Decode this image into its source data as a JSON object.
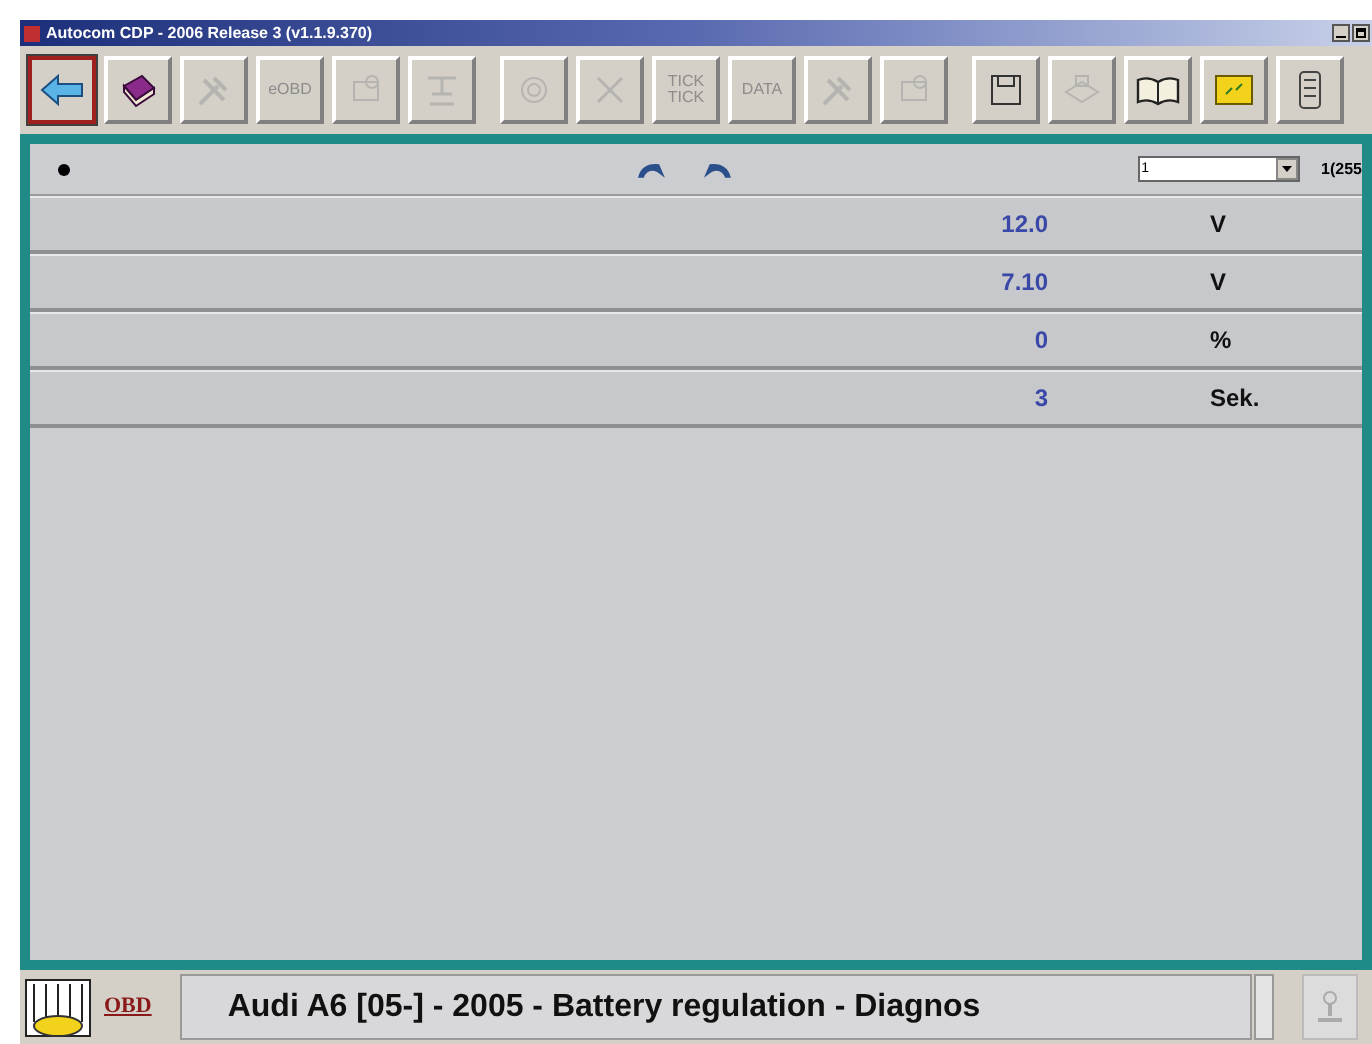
{
  "window": {
    "title": "Autocom CDP  -  2006 Release 3  (v1.1.9.370)"
  },
  "toolbar": [
    {
      "kind": "back",
      "selected": true,
      "disabled": false
    },
    {
      "kind": "book",
      "selected": false,
      "disabled": false
    },
    {
      "kind": "tools",
      "selected": false,
      "disabled": true
    },
    {
      "kind": "text",
      "label": "eOBD",
      "selected": false,
      "disabled": true
    },
    {
      "kind": "ecu",
      "selected": false,
      "disabled": true
    },
    {
      "kind": "stand",
      "selected": false,
      "disabled": true
    },
    {
      "kind": "circle",
      "selected": false,
      "disabled": true
    },
    {
      "kind": "cross",
      "selected": false,
      "disabled": true
    },
    {
      "kind": "text",
      "label": "TICK TICK",
      "selected": false,
      "disabled": true
    },
    {
      "kind": "text",
      "label": "DATA",
      "selected": false,
      "disabled": true
    },
    {
      "kind": "tools",
      "selected": false,
      "disabled": true
    },
    {
      "kind": "ecu",
      "selected": false,
      "disabled": true
    },
    {
      "kind": "save",
      "selected": false,
      "disabled": false
    },
    {
      "kind": "print",
      "selected": false,
      "disabled": true
    },
    {
      "kind": "open-book",
      "selected": false,
      "disabled": false
    },
    {
      "kind": "note",
      "selected": false,
      "disabled": false
    },
    {
      "kind": "phone",
      "selected": false,
      "disabled": false
    }
  ],
  "header": {
    "dropdown": {
      "value": "1"
    },
    "counter": "1(255"
  },
  "rows": [
    {
      "value": "12.0",
      "unit": "V"
    },
    {
      "value": "7.10",
      "unit": "V"
    },
    {
      "value": "0",
      "unit": "%"
    },
    {
      "value": "3",
      "unit": "Sek."
    }
  ],
  "bottom": {
    "logo": "OBD",
    "status": "Audi A6 [05-] - 2005 - Battery regulation - Diagnos"
  }
}
